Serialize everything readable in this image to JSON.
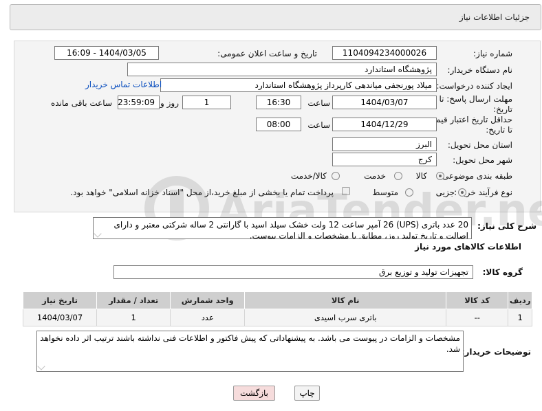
{
  "header": {
    "title": "جزئیات اطلاعات نیاز"
  },
  "form": {
    "need_number_label": "شماره نیاز:",
    "need_number": "1104094234000026",
    "announce_label": "تاریخ و ساعت اعلان عمومی:",
    "announce_value": "1404/03/05 - 16:09",
    "buyer_label": "نام دستگاه خریدار:",
    "buyer_value": "پژوهشگاه استاندارد",
    "creator_label": "ایجاد کننده درخواست:",
    "creator_value": "میلاد پورنجفی میاندهی کارپرداز پژوهشگاه استاندارد",
    "contact_link": "اطلاعات تماس خریدار",
    "deadline_label_1": "مهلت ارسال پاسخ: تا",
    "deadline_label_2": "تاریخ:",
    "deadline_date": "1404/03/07",
    "time_label": "ساعت",
    "deadline_time": "16:30",
    "days_value": "1",
    "days_label": "روز و",
    "remaining_value": "23:59:09",
    "remaining_label": "ساعت باقی مانده",
    "validity_label_1": "حداقل تاریخ اعتبار قیمت:",
    "validity_label_2": "تا تاریخ:",
    "validity_date": "1404/12/29",
    "validity_time_label": "ساعت",
    "validity_time": "08:00",
    "province_label": "استان محل تحویل:",
    "province_value": "البرز",
    "city_label": "شهر محل تحویل:",
    "city_value": "کرج",
    "category_label": "طبقه بندی موضوعی:",
    "category_options": [
      "کالا",
      "خدمت",
      "کالا/خدمت"
    ],
    "category_selected": "کالا",
    "process_label": "نوع فرآیند خرید :",
    "process_options": [
      "جزیی",
      "متوسط"
    ],
    "process_selected": "جزیی",
    "payment_note": "پرداخت تمام یا بخشی از مبلغ خرید،از محل \"اسناد خزانه اسلامی\" خواهد بود."
  },
  "description": {
    "label": "شرح کلی نیاز:",
    "text": "20 عدد باتری (UPS) 26 آمپر ساعت 12 ولت خشک سیلد اسید با گارانتی 2 ساله شرکتی معتبر و دارای اصالت و تاریخ تولید روز، مطابق با مشخصات و الزامات پیوست."
  },
  "goods": {
    "section_title": "اطلاعات کالاهای مورد نیاز",
    "group_label": "گروه کالا:",
    "group_value": "تجهیزات تولید و توزیع برق",
    "columns": [
      "ردیف",
      "کد کالا",
      "نام کالا",
      "واحد شمارش",
      "تعداد / مقدار",
      "تاریخ نیاز"
    ],
    "rows": [
      [
        "1",
        "--",
        "باتری سرب اسیدی",
        "عدد",
        "1",
        "1404/03/07"
      ]
    ]
  },
  "buyer_notes": {
    "label": "توضیحات خریدار:",
    "text": "مشخصات و الزامات در پیوست می باشد. به پیشنهاداتی که پیش فاکتور و اطلاعات فنی نداشته باشند ترتیب اثر داده نخواهد شد."
  },
  "buttons": {
    "print": "چاپ",
    "back": "بازگشت"
  },
  "watermark": {
    "text": "AriaTender.net"
  },
  "colors": {
    "link": "#0b4fbf",
    "back_button_bg": "#f6dcdc",
    "header_bg": "#ececec",
    "table_header_bg": "#cfcfcf"
  }
}
